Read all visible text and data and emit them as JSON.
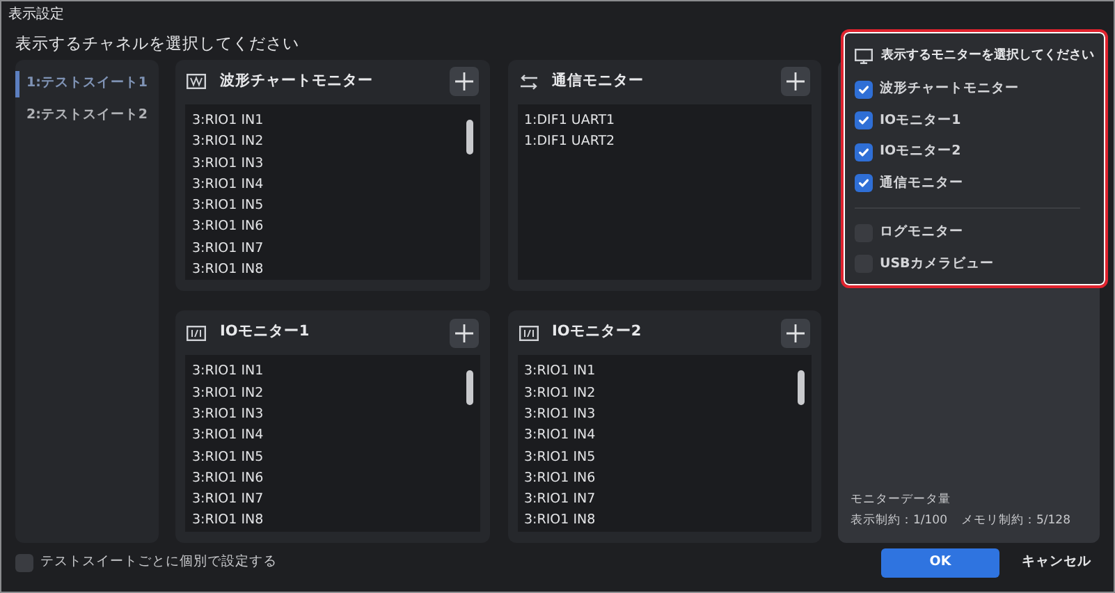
{
  "window": {
    "title": "表示設定"
  },
  "heading": "表示するチャネルを選択してください",
  "suites": [
    {
      "label": "1:テストスイート1",
      "selected": true
    },
    {
      "label": "2:テストスイート2",
      "selected": false
    }
  ],
  "panels": [
    {
      "kind": "chart",
      "title": "波形チャートモニター",
      "channels": [
        "3:RIO1 IN1",
        "3:RIO1 IN2",
        "3:RIO1 IN3",
        "3:RIO1 IN4",
        "3:RIO1 IN5",
        "3:RIO1 IN6",
        "3:RIO1 IN7",
        "3:RIO1 IN8"
      ]
    },
    {
      "kind": "comm",
      "title": "通信モニター",
      "channels": [
        "1:DIF1 UART1",
        "1:DIF1 UART2"
      ]
    },
    {
      "kind": "io",
      "title": "IOモニター1",
      "channels": [
        "3:RIO1 IN1",
        "3:RIO1 IN2",
        "3:RIO1 IN3",
        "3:RIO1 IN4",
        "3:RIO1 IN5",
        "3:RIO1 IN6",
        "3:RIO1 IN7",
        "3:RIO1 IN8"
      ]
    },
    {
      "kind": "io",
      "title": "IOモニター2",
      "channels": [
        "3:RIO1 IN1",
        "3:RIO1 IN2",
        "3:RIO1 IN3",
        "3:RIO1 IN4",
        "3:RIO1 IN5",
        "3:RIO1 IN6",
        "3:RIO1 IN7",
        "3:RIO1 IN8"
      ]
    }
  ],
  "monitor_menu": {
    "title": "表示するモニターを選択してください",
    "groups": [
      [
        {
          "label": "波形チャートモニター",
          "checked": true
        },
        {
          "label": "IOモニター1",
          "checked": true
        },
        {
          "label": "IOモニター2",
          "checked": true
        },
        {
          "label": "通信モニター",
          "checked": true
        }
      ],
      [
        {
          "label": "ログモニター",
          "checked": false
        },
        {
          "label": "USBカメラビュー",
          "checked": false
        }
      ]
    ]
  },
  "data_usage": {
    "title": "モニターデータ量",
    "display_limit": "表示制約：1/100",
    "memory_limit": "メモリ制約：5/128"
  },
  "per_suite": {
    "label": "テストスイートごとに個別で設定する",
    "checked": false
  },
  "buttons": {
    "ok": "OK",
    "cancel": "キャンセル"
  }
}
